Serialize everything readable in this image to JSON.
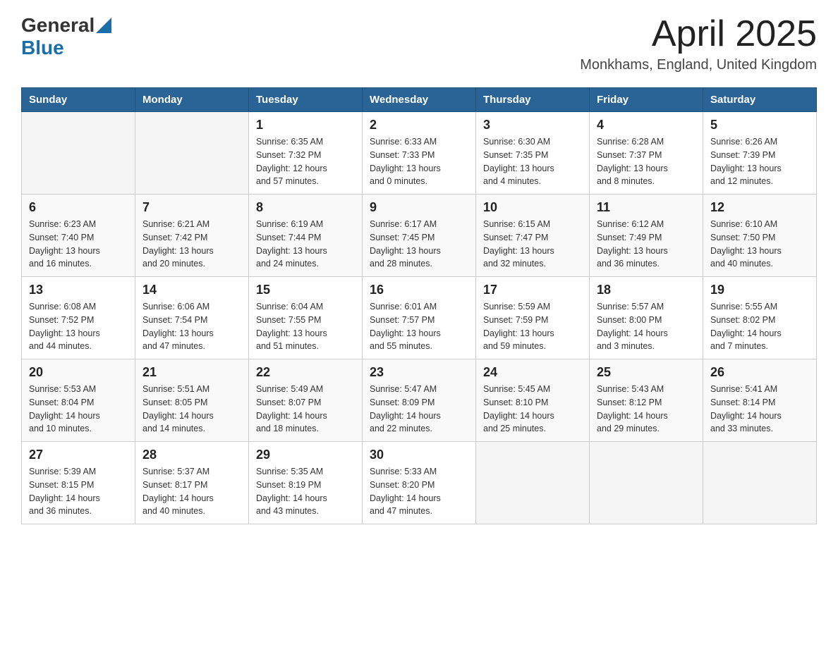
{
  "header": {
    "logo_general": "General",
    "logo_blue": "Blue",
    "title": "April 2025",
    "location": "Monkhams, England, United Kingdom"
  },
  "days_of_week": [
    "Sunday",
    "Monday",
    "Tuesday",
    "Wednesday",
    "Thursday",
    "Friday",
    "Saturday"
  ],
  "weeks": [
    [
      {
        "day": "",
        "info": ""
      },
      {
        "day": "",
        "info": ""
      },
      {
        "day": "1",
        "info": "Sunrise: 6:35 AM\nSunset: 7:32 PM\nDaylight: 12 hours\nand 57 minutes."
      },
      {
        "day": "2",
        "info": "Sunrise: 6:33 AM\nSunset: 7:33 PM\nDaylight: 13 hours\nand 0 minutes."
      },
      {
        "day": "3",
        "info": "Sunrise: 6:30 AM\nSunset: 7:35 PM\nDaylight: 13 hours\nand 4 minutes."
      },
      {
        "day": "4",
        "info": "Sunrise: 6:28 AM\nSunset: 7:37 PM\nDaylight: 13 hours\nand 8 minutes."
      },
      {
        "day": "5",
        "info": "Sunrise: 6:26 AM\nSunset: 7:39 PM\nDaylight: 13 hours\nand 12 minutes."
      }
    ],
    [
      {
        "day": "6",
        "info": "Sunrise: 6:23 AM\nSunset: 7:40 PM\nDaylight: 13 hours\nand 16 minutes."
      },
      {
        "day": "7",
        "info": "Sunrise: 6:21 AM\nSunset: 7:42 PM\nDaylight: 13 hours\nand 20 minutes."
      },
      {
        "day": "8",
        "info": "Sunrise: 6:19 AM\nSunset: 7:44 PM\nDaylight: 13 hours\nand 24 minutes."
      },
      {
        "day": "9",
        "info": "Sunrise: 6:17 AM\nSunset: 7:45 PM\nDaylight: 13 hours\nand 28 minutes."
      },
      {
        "day": "10",
        "info": "Sunrise: 6:15 AM\nSunset: 7:47 PM\nDaylight: 13 hours\nand 32 minutes."
      },
      {
        "day": "11",
        "info": "Sunrise: 6:12 AM\nSunset: 7:49 PM\nDaylight: 13 hours\nand 36 minutes."
      },
      {
        "day": "12",
        "info": "Sunrise: 6:10 AM\nSunset: 7:50 PM\nDaylight: 13 hours\nand 40 minutes."
      }
    ],
    [
      {
        "day": "13",
        "info": "Sunrise: 6:08 AM\nSunset: 7:52 PM\nDaylight: 13 hours\nand 44 minutes."
      },
      {
        "day": "14",
        "info": "Sunrise: 6:06 AM\nSunset: 7:54 PM\nDaylight: 13 hours\nand 47 minutes."
      },
      {
        "day": "15",
        "info": "Sunrise: 6:04 AM\nSunset: 7:55 PM\nDaylight: 13 hours\nand 51 minutes."
      },
      {
        "day": "16",
        "info": "Sunrise: 6:01 AM\nSunset: 7:57 PM\nDaylight: 13 hours\nand 55 minutes."
      },
      {
        "day": "17",
        "info": "Sunrise: 5:59 AM\nSunset: 7:59 PM\nDaylight: 13 hours\nand 59 minutes."
      },
      {
        "day": "18",
        "info": "Sunrise: 5:57 AM\nSunset: 8:00 PM\nDaylight: 14 hours\nand 3 minutes."
      },
      {
        "day": "19",
        "info": "Sunrise: 5:55 AM\nSunset: 8:02 PM\nDaylight: 14 hours\nand 7 minutes."
      }
    ],
    [
      {
        "day": "20",
        "info": "Sunrise: 5:53 AM\nSunset: 8:04 PM\nDaylight: 14 hours\nand 10 minutes."
      },
      {
        "day": "21",
        "info": "Sunrise: 5:51 AM\nSunset: 8:05 PM\nDaylight: 14 hours\nand 14 minutes."
      },
      {
        "day": "22",
        "info": "Sunrise: 5:49 AM\nSunset: 8:07 PM\nDaylight: 14 hours\nand 18 minutes."
      },
      {
        "day": "23",
        "info": "Sunrise: 5:47 AM\nSunset: 8:09 PM\nDaylight: 14 hours\nand 22 minutes."
      },
      {
        "day": "24",
        "info": "Sunrise: 5:45 AM\nSunset: 8:10 PM\nDaylight: 14 hours\nand 25 minutes."
      },
      {
        "day": "25",
        "info": "Sunrise: 5:43 AM\nSunset: 8:12 PM\nDaylight: 14 hours\nand 29 minutes."
      },
      {
        "day": "26",
        "info": "Sunrise: 5:41 AM\nSunset: 8:14 PM\nDaylight: 14 hours\nand 33 minutes."
      }
    ],
    [
      {
        "day": "27",
        "info": "Sunrise: 5:39 AM\nSunset: 8:15 PM\nDaylight: 14 hours\nand 36 minutes."
      },
      {
        "day": "28",
        "info": "Sunrise: 5:37 AM\nSunset: 8:17 PM\nDaylight: 14 hours\nand 40 minutes."
      },
      {
        "day": "29",
        "info": "Sunrise: 5:35 AM\nSunset: 8:19 PM\nDaylight: 14 hours\nand 43 minutes."
      },
      {
        "day": "30",
        "info": "Sunrise: 5:33 AM\nSunset: 8:20 PM\nDaylight: 14 hours\nand 47 minutes."
      },
      {
        "day": "",
        "info": ""
      },
      {
        "day": "",
        "info": ""
      },
      {
        "day": "",
        "info": ""
      }
    ]
  ]
}
